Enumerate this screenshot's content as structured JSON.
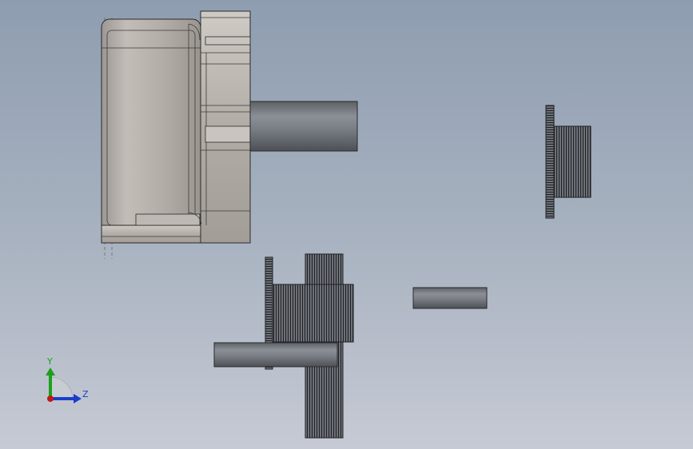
{
  "viewport": {
    "background_top": "#8e9db0",
    "background_bottom": "#c6cad4"
  },
  "triad": {
    "y_label": "Y",
    "z_label": "Z",
    "y_color": "#1ca01c",
    "z_color": "#1a3ec8",
    "origin_color": "#c01818"
  },
  "parts": [
    {
      "name": "motor-housing",
      "icon": "motor-housing-icon"
    },
    {
      "name": "motor-shaft",
      "icon": "shaft-icon"
    },
    {
      "name": "small-gear",
      "icon": "gear-icon"
    },
    {
      "name": "compound-gear",
      "icon": "gear-icon"
    },
    {
      "name": "idler-pin",
      "icon": "shaft-icon"
    },
    {
      "name": "long-shaft",
      "icon": "shaft-icon"
    }
  ]
}
